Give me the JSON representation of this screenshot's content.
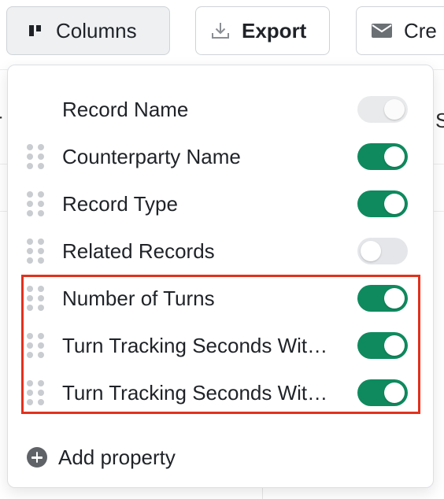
{
  "toolbar": {
    "columns_label": "Columns",
    "export_label": "Export",
    "create_label": "Cre"
  },
  "background": {
    "left_fragment": "r",
    "right_fragment": "S"
  },
  "columns_menu": {
    "items": [
      {
        "label": "Record Name",
        "enabled": true,
        "locked": true
      },
      {
        "label": "Counterparty Name",
        "enabled": true,
        "locked": false
      },
      {
        "label": "Record Type",
        "enabled": true,
        "locked": false
      },
      {
        "label": "Related Records",
        "enabled": false,
        "locked": false
      },
      {
        "label": "Number of Turns",
        "enabled": true,
        "locked": false
      },
      {
        "label": "Turn Tracking Seconds Wit…",
        "enabled": true,
        "locked": false
      },
      {
        "label": "Turn Tracking Seconds Wit…",
        "enabled": true,
        "locked": false
      }
    ],
    "add_property_label": "Add property"
  },
  "colors": {
    "toggle_on": "#0f8a5f",
    "toggle_off": "#e4e6e9",
    "highlight_border": "#e2311d"
  },
  "icons": {
    "columns": "columns-icon",
    "export": "download-icon",
    "create": "mail-icon",
    "drag": "drag-handle-icon",
    "add": "plus-circle-icon"
  }
}
